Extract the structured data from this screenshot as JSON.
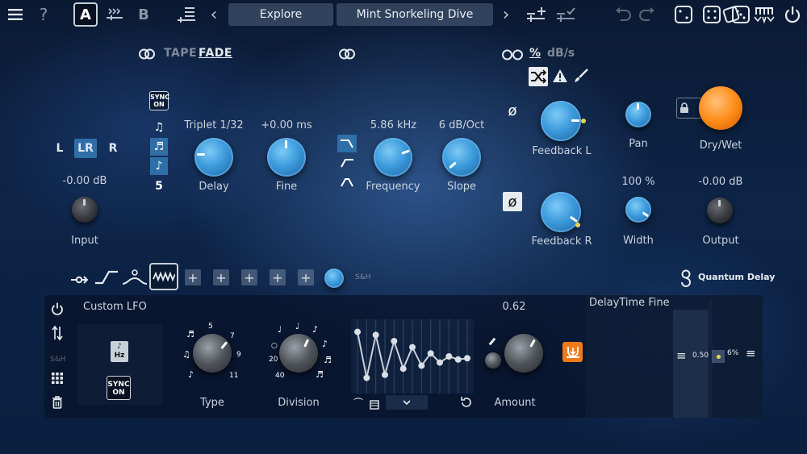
{
  "topbar": {
    "menu_icon": "menu-icon",
    "help": "?",
    "a_label": "A",
    "b_label": "B",
    "preset_category": "Explore",
    "preset_name": "Mint Snorkeling Dive",
    "prev": "‹",
    "next": "›"
  },
  "tape": {
    "word1": "TAPE",
    "word2": "FADE"
  },
  "rate_units": {
    "percent": "%",
    "dbs": "dB/s"
  },
  "channels": {
    "l": "L",
    "lr": "LR",
    "r": "R"
  },
  "sync": {
    "line1": "SYNC",
    "line2": "ON"
  },
  "note_divider": "5",
  "delay": {
    "value": "Triplet 1/32",
    "label": "Delay"
  },
  "fine": {
    "value": "+0.00 ms",
    "label": "Fine"
  },
  "frequency": {
    "value": "5.86 kHz",
    "label": "Frequency"
  },
  "slope": {
    "value": "6 dB/Oct",
    "label": "Slope"
  },
  "input": {
    "value": "-0.00 dB",
    "label": "Input"
  },
  "feedback_l": {
    "label": "Feedback L"
  },
  "feedback_r": {
    "label": "Feedback R"
  },
  "pan": {
    "label": "Pan"
  },
  "width": {
    "value": "100 %",
    "label": "Width"
  },
  "drywet": {
    "label": "Dry/Wet"
  },
  "output": {
    "value": "-0.00 dB",
    "label": "Output"
  },
  "phase_symbol": "ø",
  "sh_label": "S&H",
  "brand": "Quantum Delay",
  "lfo": {
    "title": "Custom LFO",
    "type_label": "Type",
    "division_label": "Division",
    "amount_label": "Amount",
    "amount_value": "0.62",
    "hz_label": "Hz",
    "sync_line1": "SYNC",
    "sync_line2": "ON",
    "sh": "S&H",
    "type_marks": [
      "5",
      "7",
      "9",
      "11"
    ],
    "division_marks": [
      "20",
      "40"
    ],
    "graph_steps": [
      0.9,
      0.15,
      0.85,
      0.2,
      0.75,
      0.3,
      0.65,
      0.35,
      0.55,
      0.4,
      0.5,
      0.45,
      0.47
    ],
    "destination": "DelayTime Fine",
    "dt_value": "0.50",
    "dt_percent": "6%"
  },
  "colors": {
    "accent": "#2f6fa8",
    "orange": "#ff8c1a",
    "lfo_accent": "#f07a1a"
  }
}
